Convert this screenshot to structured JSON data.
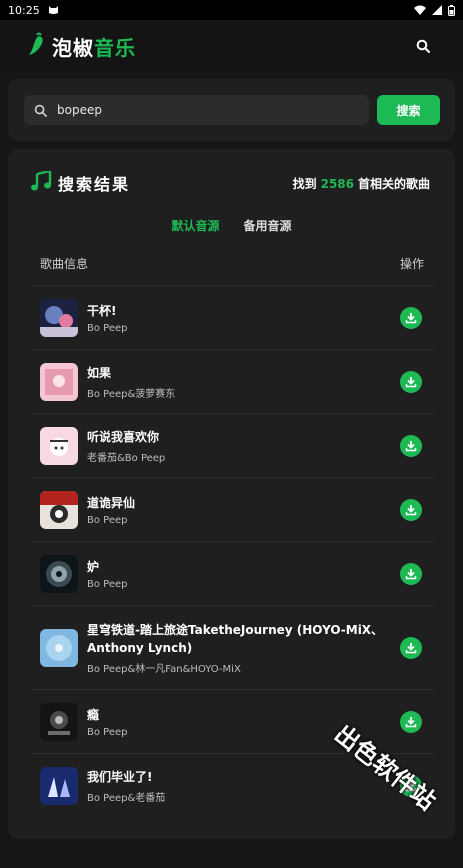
{
  "status_bar": {
    "time": "10:25"
  },
  "header": {
    "logo_part1": "泡椒",
    "logo_part2": "音乐",
    "search_icon": "search-icon"
  },
  "search": {
    "value": "bopeep",
    "button_label": "搜索"
  },
  "results": {
    "title": "搜索结果",
    "count_prefix": "找到",
    "count": "2586",
    "count_suffix": "首相关的歌曲",
    "tabs": [
      {
        "label": "默认音源",
        "active": true
      },
      {
        "label": "备用音源",
        "active": false
      }
    ],
    "col_info": "歌曲信息",
    "col_action": "操作",
    "songs": [
      {
        "title": "干杯!",
        "artist": "Bo Peep"
      },
      {
        "title": "如果",
        "artist": "Bo Peep&菠萝赛东"
      },
      {
        "title": "听说我喜欢你",
        "artist": "老番茄&Bo Peep"
      },
      {
        "title": "道诡异仙",
        "artist": "Bo Peep"
      },
      {
        "title": "妒",
        "artist": "Bo Peep"
      },
      {
        "title": "星穹铁道-踏上旅途TaketheJourney (HOYO-MiX、Anthony Lynch)",
        "artist": "Bo Peep&林一凡Fan&HOYO-MiX"
      },
      {
        "title": "瘾",
        "artist": "Bo Peep"
      },
      {
        "title": "我们毕业了!",
        "artist": "Bo Peep&老番茄"
      }
    ]
  },
  "watermark": "出色软件站",
  "colors": {
    "accent": "#1db954",
    "background": "#161616",
    "card": "#1f1f1f"
  }
}
